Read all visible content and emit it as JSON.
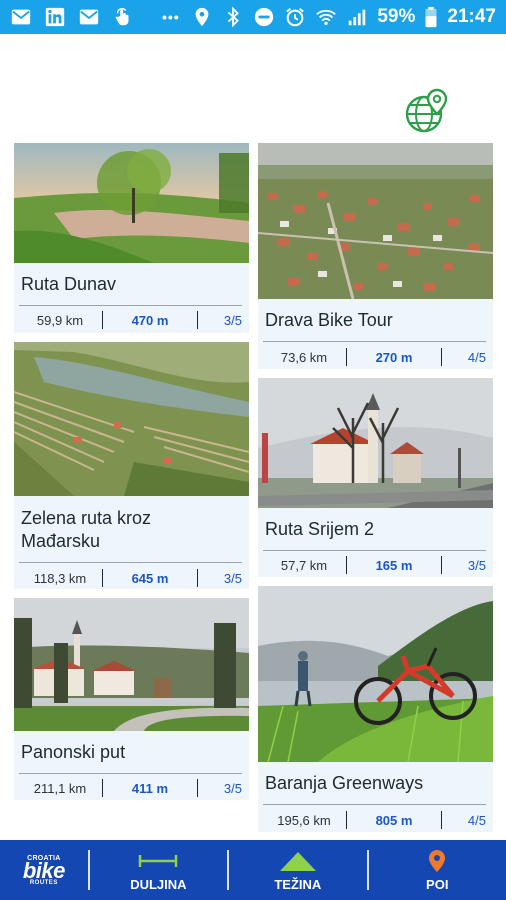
{
  "status_bar": {
    "battery": "59%",
    "time": "21:47",
    "more": "•••"
  },
  "routes": [
    {
      "title": "Ruta Dunav",
      "km": "59,9 km",
      "elevation": "470 m",
      "difficulty": "3/5"
    },
    {
      "title": "Drava Bike Tour",
      "km": "73,6 km",
      "elevation": "270 m",
      "difficulty": "4/5"
    },
    {
      "title": "Zelena ruta kroz Mađarsku",
      "km": "118,3 km",
      "elevation": "645 m",
      "difficulty": "3/5"
    },
    {
      "title": "Ruta Srijem 2",
      "km": "57,7 km",
      "elevation": "165 m",
      "difficulty": "3/5"
    },
    {
      "title": "Panonski put",
      "km": "211,1 km",
      "elevation": "411 m",
      "difficulty": "3/5"
    },
    {
      "title": "Baranja Greenways",
      "km": "195,6 km",
      "elevation": "805 m",
      "difficulty": "4/5"
    }
  ],
  "nav": {
    "logo_top": "CROATIA",
    "logo_main": "bike",
    "logo_bottom": "ROUTES",
    "length": "DULJINA",
    "difficulty": "TEŽINA",
    "poi": "POI"
  },
  "colors": {
    "status_bar": "#1aa3e8",
    "nav_bar": "#1547b3",
    "card_bg": "#eef6fc",
    "accent_blue": "#1a56c4",
    "globe_green": "#2e9e4a",
    "poi_orange": "#f07a2a"
  }
}
